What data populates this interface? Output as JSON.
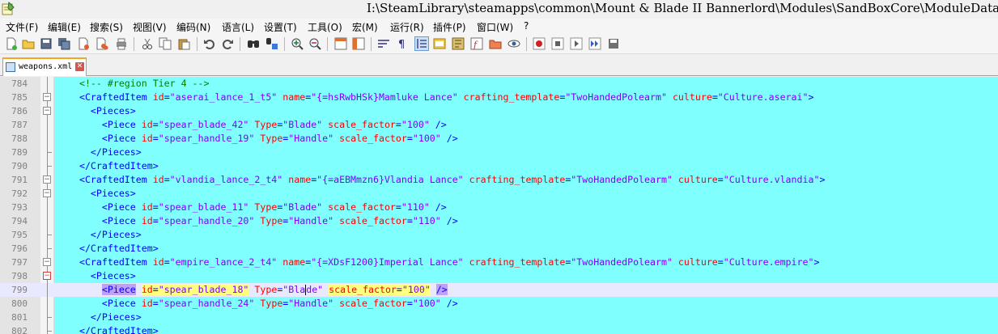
{
  "window": {
    "title": "I:\\SteamLibrary\\steamapps\\common\\Mount & Blade II Bannerlord\\Modules\\SandBoxCore\\ModuleData\\spitems\\weapons.xml - Notepad++"
  },
  "menu": {
    "items": [
      "文件(F)",
      "编辑(E)",
      "搜索(S)",
      "视图(V)",
      "编码(N)",
      "语言(L)",
      "设置(T)",
      "工具(O)",
      "宏(M)",
      "运行(R)",
      "插件(P)",
      "窗口(W)",
      "?"
    ]
  },
  "toolbar": {
    "icons": [
      "new-file-icon",
      "open-file-icon",
      "save-icon",
      "save-all-icon",
      "close-icon",
      "close-all-icon",
      "print-icon",
      "cut-icon",
      "copy-icon",
      "paste-icon",
      "undo-icon",
      "redo-icon",
      "find-icon",
      "replace-icon",
      "zoom-in-icon",
      "zoom-out-icon",
      "sync-vertical-icon",
      "sync-horizontal-icon",
      "word-wrap-icon",
      "show-all-chars-icon",
      "indent-guide-icon",
      "udl-icon",
      "doc-map-icon",
      "function-list-icon",
      "folder-as-workspace-icon",
      "monitoring-icon",
      "record-macro-icon",
      "stop-recording-icon",
      "play-macro-icon",
      "run-macro-multiple-icon",
      "save-macro-icon"
    ]
  },
  "tabs": [
    {
      "label": "weapons.xml",
      "active": true
    }
  ],
  "editor": {
    "lines": [
      {
        "num": "784",
        "fold": "line",
        "parts": [
          [
            "comment",
            "  <!-- #region Tier 4 -->"
          ]
        ]
      },
      {
        "num": "785",
        "fold": "box",
        "parts": [
          [
            "text",
            "  "
          ],
          [
            "tag",
            "<CraftedItem"
          ],
          [
            "text",
            " "
          ],
          [
            "attr",
            "id"
          ],
          [
            "punc",
            "="
          ],
          [
            "val",
            "\"aserai_lance_1_t5\""
          ],
          [
            "text",
            " "
          ],
          [
            "attr",
            "name"
          ],
          [
            "punc",
            "="
          ],
          [
            "val",
            "\"{=hsRwbHSk}Mamluke Lance\""
          ],
          [
            "text",
            " "
          ],
          [
            "attr",
            "crafting_template"
          ],
          [
            "punc",
            "="
          ],
          [
            "val",
            "\"TwoHandedPolearm\""
          ],
          [
            "text",
            " "
          ],
          [
            "attr",
            "culture"
          ],
          [
            "punc",
            "="
          ],
          [
            "val",
            "\"Culture.aserai\""
          ],
          [
            "tag",
            ">"
          ]
        ]
      },
      {
        "num": "786",
        "fold": "box",
        "parts": [
          [
            "text",
            "    "
          ],
          [
            "tag",
            "<Pieces>"
          ]
        ]
      },
      {
        "num": "787",
        "fold": "line",
        "parts": [
          [
            "text",
            "      "
          ],
          [
            "tag",
            "<Piece"
          ],
          [
            "text",
            " "
          ],
          [
            "attr",
            "id"
          ],
          [
            "punc",
            "="
          ],
          [
            "val",
            "\"spear_blade_42\""
          ],
          [
            "text",
            " "
          ],
          [
            "attr",
            "Type"
          ],
          [
            "punc",
            "="
          ],
          [
            "val",
            "\"Blade\""
          ],
          [
            "text",
            " "
          ],
          [
            "attr",
            "scale_factor"
          ],
          [
            "punc",
            "="
          ],
          [
            "val",
            "\"100\""
          ],
          [
            "text",
            " "
          ],
          [
            "tag",
            "/>"
          ]
        ]
      },
      {
        "num": "788",
        "fold": "line",
        "parts": [
          [
            "text",
            "      "
          ],
          [
            "tag",
            "<Piece"
          ],
          [
            "text",
            " "
          ],
          [
            "attr",
            "id"
          ],
          [
            "punc",
            "="
          ],
          [
            "val",
            "\"spear_handle_19\""
          ],
          [
            "text",
            " "
          ],
          [
            "attr",
            "Type"
          ],
          [
            "punc",
            "="
          ],
          [
            "val",
            "\"Handle\""
          ],
          [
            "text",
            " "
          ],
          [
            "attr",
            "scale_factor"
          ],
          [
            "punc",
            "="
          ],
          [
            "val",
            "\"100\""
          ],
          [
            "text",
            " "
          ],
          [
            "tag",
            "/>"
          ]
        ]
      },
      {
        "num": "789",
        "fold": "end",
        "parts": [
          [
            "text",
            "    "
          ],
          [
            "tag",
            "</Pieces>"
          ]
        ]
      },
      {
        "num": "790",
        "fold": "end",
        "parts": [
          [
            "text",
            "  "
          ],
          [
            "tag",
            "</CraftedItem>"
          ]
        ]
      },
      {
        "num": "791",
        "fold": "box",
        "parts": [
          [
            "text",
            "  "
          ],
          [
            "tag",
            "<CraftedItem"
          ],
          [
            "text",
            " "
          ],
          [
            "attr",
            "id"
          ],
          [
            "punc",
            "="
          ],
          [
            "val",
            "\"vlandia_lance_2_t4\""
          ],
          [
            "text",
            " "
          ],
          [
            "attr",
            "name"
          ],
          [
            "punc",
            "="
          ],
          [
            "val",
            "\"{=aEBMmzn6}Vlandia Lance\""
          ],
          [
            "text",
            " "
          ],
          [
            "attr",
            "crafting_template"
          ],
          [
            "punc",
            "="
          ],
          [
            "val",
            "\"TwoHandedPolearm\""
          ],
          [
            "text",
            " "
          ],
          [
            "attr",
            "culture"
          ],
          [
            "punc",
            "="
          ],
          [
            "val",
            "\"Culture.vlandia\""
          ],
          [
            "tag",
            ">"
          ]
        ]
      },
      {
        "num": "792",
        "fold": "box",
        "parts": [
          [
            "text",
            "    "
          ],
          [
            "tag",
            "<Pieces>"
          ]
        ]
      },
      {
        "num": "793",
        "fold": "line",
        "parts": [
          [
            "text",
            "      "
          ],
          [
            "tag",
            "<Piece"
          ],
          [
            "text",
            " "
          ],
          [
            "attr",
            "id"
          ],
          [
            "punc",
            "="
          ],
          [
            "val",
            "\"spear_blade_11\""
          ],
          [
            "text",
            " "
          ],
          [
            "attr",
            "Type"
          ],
          [
            "punc",
            "="
          ],
          [
            "val",
            "\"Blade\""
          ],
          [
            "text",
            " "
          ],
          [
            "attr",
            "scale_factor"
          ],
          [
            "punc",
            "="
          ],
          [
            "val",
            "\"110\""
          ],
          [
            "text",
            " "
          ],
          [
            "tag",
            "/>"
          ]
        ]
      },
      {
        "num": "794",
        "fold": "line",
        "parts": [
          [
            "text",
            "      "
          ],
          [
            "tag",
            "<Piece"
          ],
          [
            "text",
            " "
          ],
          [
            "attr",
            "id"
          ],
          [
            "punc",
            "="
          ],
          [
            "val",
            "\"spear_handle_20\""
          ],
          [
            "text",
            " "
          ],
          [
            "attr",
            "Type"
          ],
          [
            "punc",
            "="
          ],
          [
            "val",
            "\"Handle\""
          ],
          [
            "text",
            " "
          ],
          [
            "attr",
            "scale_factor"
          ],
          [
            "punc",
            "="
          ],
          [
            "val",
            "\"110\""
          ],
          [
            "text",
            " "
          ],
          [
            "tag",
            "/>"
          ]
        ]
      },
      {
        "num": "795",
        "fold": "end",
        "parts": [
          [
            "text",
            "    "
          ],
          [
            "tag",
            "</Pieces>"
          ]
        ]
      },
      {
        "num": "796",
        "fold": "end",
        "parts": [
          [
            "text",
            "  "
          ],
          [
            "tag",
            "</CraftedItem>"
          ]
        ]
      },
      {
        "num": "797",
        "fold": "box",
        "parts": [
          [
            "text",
            "  "
          ],
          [
            "tag",
            "<CraftedItem"
          ],
          [
            "text",
            " "
          ],
          [
            "attr",
            "id"
          ],
          [
            "punc",
            "="
          ],
          [
            "val",
            "\"empire_lance_2_t4\""
          ],
          [
            "text",
            " "
          ],
          [
            "attr",
            "name"
          ],
          [
            "punc",
            "="
          ],
          [
            "val",
            "\"{=XDsF1200}Imperial Lance\""
          ],
          [
            "text",
            " "
          ],
          [
            "attr",
            "crafting_template"
          ],
          [
            "punc",
            "="
          ],
          [
            "val",
            "\"TwoHandedPolearm\""
          ],
          [
            "text",
            " "
          ],
          [
            "attr",
            "culture"
          ],
          [
            "punc",
            "="
          ],
          [
            "val",
            "\"Culture.empire\""
          ],
          [
            "tag",
            ">"
          ]
        ]
      },
      {
        "num": "798",
        "fold": "boxred",
        "parts": [
          [
            "text",
            "    "
          ],
          [
            "tag",
            "<Pieces>"
          ]
        ]
      },
      {
        "num": "799",
        "fold": "line",
        "current": true,
        "parts": [
          [
            "text",
            "      "
          ],
          [
            "tag",
            "<Piece",
            "sel"
          ],
          [
            "text",
            " "
          ],
          [
            "attr",
            "id",
            "match"
          ],
          [
            "punc",
            "=",
            "match"
          ],
          [
            "val",
            "\"spear_blade_18\"",
            "match"
          ],
          [
            "text",
            " "
          ],
          [
            "attr",
            "Type"
          ],
          [
            "punc",
            "="
          ],
          [
            "val",
            "\"Bla"
          ],
          [
            "caret",
            ""
          ],
          [
            "val",
            "de\""
          ],
          [
            "text",
            " "
          ],
          [
            "attr",
            "scale_factor",
            "match"
          ],
          [
            "punc",
            "=",
            "match"
          ],
          [
            "val",
            "\"100\"",
            "match"
          ],
          [
            "text",
            " "
          ],
          [
            "tag",
            "/>",
            "sel"
          ]
        ]
      },
      {
        "num": "800",
        "fold": "line",
        "parts": [
          [
            "text",
            "      "
          ],
          [
            "tag",
            "<Piece"
          ],
          [
            "text",
            " "
          ],
          [
            "attr",
            "id"
          ],
          [
            "punc",
            "="
          ],
          [
            "val",
            "\"spear_handle_24\""
          ],
          [
            "text",
            " "
          ],
          [
            "attr",
            "Type"
          ],
          [
            "punc",
            "="
          ],
          [
            "val",
            "\"Handle\""
          ],
          [
            "text",
            " "
          ],
          [
            "attr",
            "scale_factor"
          ],
          [
            "punc",
            "="
          ],
          [
            "val",
            "\"100\""
          ],
          [
            "text",
            " "
          ],
          [
            "tag",
            "/>"
          ]
        ]
      },
      {
        "num": "801",
        "fold": "end",
        "parts": [
          [
            "text",
            "    "
          ],
          [
            "tag",
            "</Pieces>"
          ]
        ]
      },
      {
        "num": "802",
        "fold": "end",
        "parts": [
          [
            "text",
            "  "
          ],
          [
            "tag",
            "</CraftedItem>"
          ]
        ]
      }
    ]
  }
}
